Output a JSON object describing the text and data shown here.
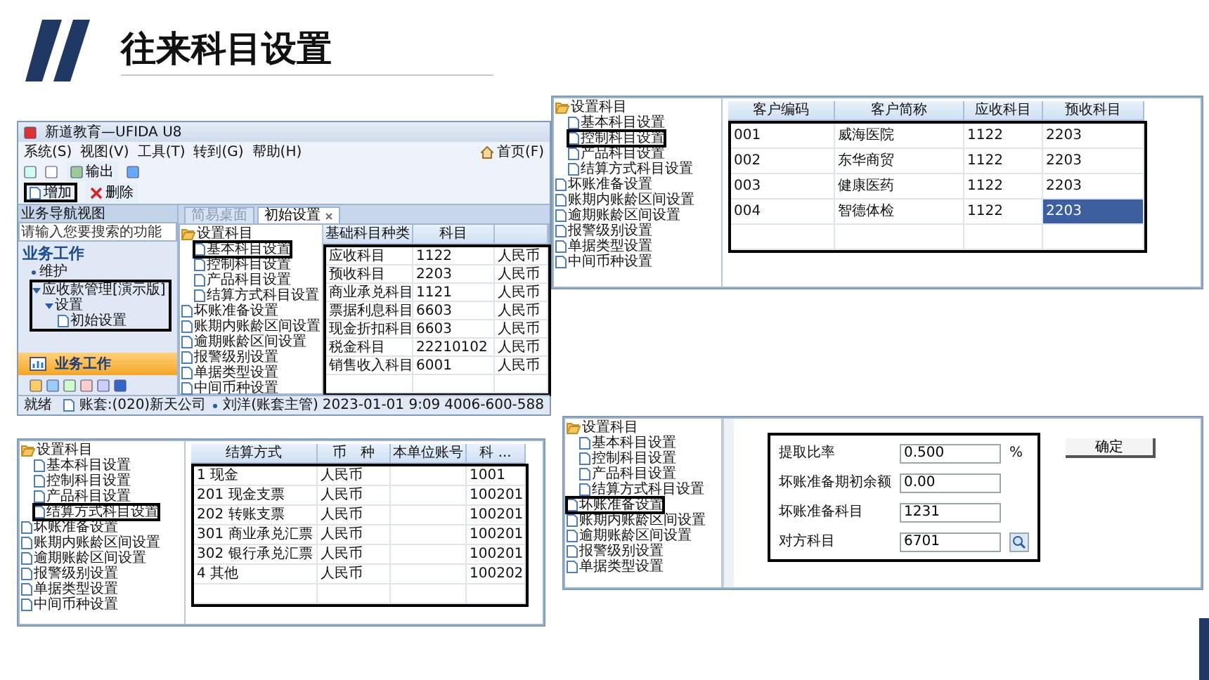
{
  "slide": {
    "title": "往来科目设置"
  },
  "main_window": {
    "title": "新道教育—UFIDA U8",
    "menu": [
      "系统(S)",
      "视图(V)",
      "工具(T)",
      "转到(G)",
      "帮助(H)"
    ],
    "home_link": "首页(F)",
    "export_button": "输出",
    "actions": [
      {
        "label": "增加",
        "kind": "add",
        "highlighted": true
      },
      {
        "label": "删除",
        "kind": "delete",
        "highlighted": false
      }
    ],
    "nav": {
      "header": "业务导航视图",
      "search_placeholder": "请输入您要搜索的功能",
      "section": "业务工作",
      "tree": [
        {
          "label": "维护",
          "highlighted": false
        },
        {
          "label": "应收款管理[演示版]",
          "highlighted": true,
          "expanded": true,
          "children": [
            {
              "label": "设置",
              "highlighted": false,
              "expanded": true,
              "children": [
                {
                  "label": "初始设置",
                  "highlighted": false
                }
              ]
            }
          ]
        }
      ],
      "bar": "业务工作"
    },
    "tabs": [
      {
        "label": "简易桌面",
        "selected": false
      },
      {
        "label": "初始设置",
        "selected": true
      }
    ],
    "tree": [
      {
        "label": "设置科目",
        "highlighted": false,
        "expanded": true,
        "children": [
          {
            "label": "基本科目设置",
            "highlighted": true
          },
          {
            "label": "控制科目设置",
            "highlighted": false
          },
          {
            "label": "产品科目设置",
            "highlighted": false
          },
          {
            "label": "结算方式科目设置",
            "highlighted": false
          }
        ]
      },
      {
        "label": "坏账准备设置",
        "highlighted": false
      },
      {
        "label": "账期内账龄区间设置",
        "highlighted": false
      },
      {
        "label": "逾期账龄区间设置",
        "highlighted": false
      },
      {
        "label": "报警级别设置",
        "highlighted": false
      },
      {
        "label": "单据类型设置",
        "highlighted": false
      },
      {
        "label": "中间币种设置",
        "highlighted": false
      }
    ],
    "table": {
      "columns": [
        "基础科目种类",
        "科目"
      ],
      "highlighted": true,
      "rows": [
        {
          "cells": [
            "应收科目",
            "1122",
            "人民币"
          ]
        },
        {
          "cells": [
            "预收科目",
            "2203",
            "人民币"
          ]
        },
        {
          "cells": [
            "商业承兑科目",
            "1121",
            "人民币"
          ]
        },
        {
          "cells": [
            "票据利息科目",
            "6603",
            "人民币"
          ]
        },
        {
          "cells": [
            "现金折扣科目",
            "6603",
            "人民币"
          ]
        },
        {
          "cells": [
            "税金科目",
            "22210102",
            "人民币"
          ]
        },
        {
          "cells": [
            "销售收入科目",
            "6001",
            "人民币"
          ]
        }
      ]
    },
    "status": {
      "ready": "就绪",
      "account": "账套:(020)新天公司",
      "user": "刘洋(账套主管)",
      "date": "2023-01-01 9:09",
      "phone": "4006-600-588"
    }
  },
  "control_window": {
    "tree": [
      {
        "label": "设置科目",
        "highlighted": false,
        "expanded": true,
        "children": [
          {
            "label": "基本科目设置",
            "highlighted": false
          },
          {
            "label": "控制科目设置",
            "highlighted": true
          },
          {
            "label": "产品科目设置",
            "highlighted": false
          },
          {
            "label": "结算方式科目设置",
            "highlighted": false
          }
        ]
      },
      {
        "label": "坏账准备设置",
        "highlighted": false
      },
      {
        "label": "账期内账龄区间设置",
        "highlighted": false
      },
      {
        "label": "逾期账龄区间设置",
        "highlighted": false
      },
      {
        "label": "报警级别设置",
        "highlighted": false
      },
      {
        "label": "单据类型设置",
        "highlighted": false
      },
      {
        "label": "中间币种设置",
        "highlighted": false
      }
    ],
    "table": {
      "columns": [
        "客户编码",
        "客户简称",
        "应收科目",
        "预收科目"
      ],
      "highlighted": true,
      "rows": [
        {
          "cells": [
            "001",
            "威海医院",
            "1122",
            "2203"
          ],
          "selected": false
        },
        {
          "cells": [
            "002",
            "东华商贸",
            "1122",
            "2203"
          ],
          "selected": false
        },
        {
          "cells": [
            "003",
            "健康医药",
            "1122",
            "2203"
          ],
          "selected": false
        },
        {
          "cells": [
            "004",
            "智德体检",
            "1122",
            "2203"
          ],
          "selected": true
        }
      ]
    }
  },
  "settlement_window": {
    "tree": [
      {
        "label": "设置科目",
        "highlighted": false,
        "expanded": true,
        "children": [
          {
            "label": "基本科目设置",
            "highlighted": false
          },
          {
            "label": "控制科目设置",
            "highlighted": false
          },
          {
            "label": "产品科目设置",
            "highlighted": false
          },
          {
            "label": "结算方式科目设置",
            "highlighted": true
          }
        ]
      },
      {
        "label": "坏账准备设置",
        "highlighted": false
      },
      {
        "label": "账期内账龄区间设置",
        "highlighted": false
      },
      {
        "label": "逾期账龄区间设置",
        "highlighted": false
      },
      {
        "label": "报警级别设置",
        "highlighted": false
      },
      {
        "label": "单据类型设置",
        "highlighted": false
      },
      {
        "label": "中间币种设置",
        "highlighted": false
      }
    ],
    "table": {
      "columns": [
        "结算方式",
        "币　种",
        "本单位账号",
        "科 ..."
      ],
      "highlighted": true,
      "rows": [
        {
          "cells": [
            "1 现金",
            "人民币",
            "",
            "1001"
          ]
        },
        {
          "cells": [
            "201 现金支票",
            "人民币",
            "",
            "100201"
          ]
        },
        {
          "cells": [
            "202 转账支票",
            "人民币",
            "",
            "100201"
          ]
        },
        {
          "cells": [
            "301 商业承兑汇票",
            "人民币",
            "",
            "100201"
          ]
        },
        {
          "cells": [
            "302 银行承兑汇票",
            "人民币",
            "",
            "100201"
          ]
        },
        {
          "cells": [
            "4 其他",
            "人民币",
            "",
            "100202"
          ]
        }
      ]
    }
  },
  "bad_debt_window": {
    "tree": [
      {
        "label": "设置科目",
        "highlighted": false,
        "expanded": true,
        "children": [
          {
            "label": "基本科目设置",
            "highlighted": false
          },
          {
            "label": "控制科目设置",
            "highlighted": false
          },
          {
            "label": "产品科目设置",
            "highlighted": false
          },
          {
            "label": "结算方式科目设置",
            "highlighted": false
          }
        ]
      },
      {
        "label": "坏账准备设置",
        "highlighted": true
      },
      {
        "label": "账期内账龄区间设置",
        "highlighted": false
      },
      {
        "label": "逾期账龄区间设置",
        "highlighted": false
      },
      {
        "label": "报警级别设置",
        "highlighted": false
      },
      {
        "label": "单据类型设置",
        "highlighted": false
      }
    ],
    "form": {
      "highlighted": true,
      "fields": [
        {
          "label": "提取比率",
          "value": "0.500",
          "unit": "%",
          "kind": "text"
        },
        {
          "label": "坏账准备期初余额",
          "value": "0.00",
          "kind": "text"
        },
        {
          "label": "坏账准备科目",
          "value": "1231",
          "kind": "text"
        },
        {
          "label": "对方科目",
          "value": "6701",
          "kind": "lookup"
        }
      ]
    },
    "confirm_button": "确定"
  }
}
